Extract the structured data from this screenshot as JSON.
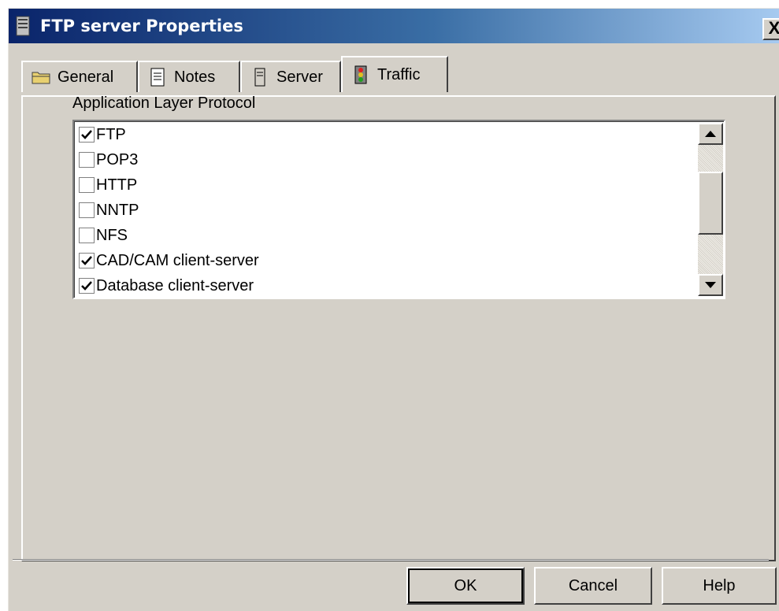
{
  "window": {
    "title": "FTP server Properties",
    "close_label": "X",
    "icon": "server-icon"
  },
  "tabs": [
    {
      "label": "General",
      "icon": "folder-icon",
      "active": false
    },
    {
      "label": "Notes",
      "icon": "notes-icon",
      "active": false
    },
    {
      "label": "Server",
      "icon": "server-icon",
      "active": false
    },
    {
      "label": "Traffic",
      "icon": "traffic-light-icon",
      "active": true
    }
  ],
  "protocols": {
    "group_label": "Application Layer Protocol",
    "items": [
      {
        "label": "FTP",
        "checked": true
      },
      {
        "label": "POP3",
        "checked": false
      },
      {
        "label": "HTTP",
        "checked": false
      },
      {
        "label": "NNTP",
        "checked": false
      },
      {
        "label": "NFS",
        "checked": false
      },
      {
        "label": "CAD/CAM client-server",
        "checked": true
      },
      {
        "label": "Database client-server",
        "checked": true
      }
    ]
  },
  "buttons": {
    "ok": "OK",
    "cancel": "Cancel",
    "help": "Help"
  }
}
